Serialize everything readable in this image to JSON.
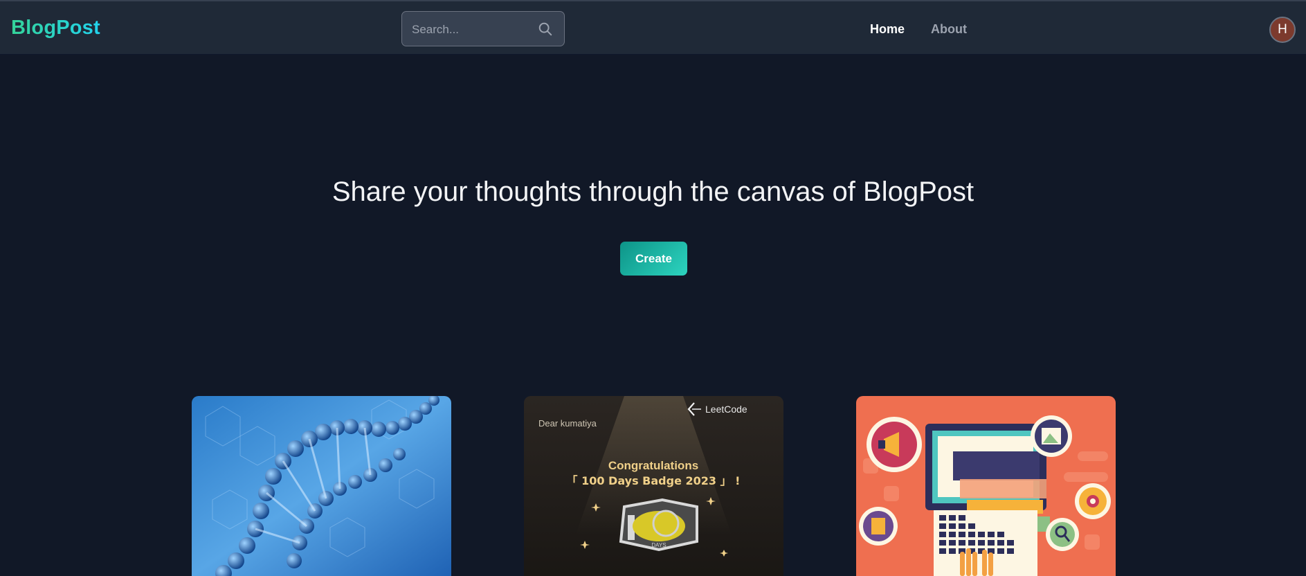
{
  "header": {
    "logo": "BlogPost",
    "search_placeholder": "Search...",
    "nav": {
      "home": "Home",
      "about": "About"
    },
    "avatar_initial": "H"
  },
  "hero": {
    "title": "Share your thoughts through the canvas of BlogPost",
    "create_label": "Create"
  },
  "cards": [
    {
      "image": "dna-helix-image"
    },
    {
      "image": "leetcode-badge-image",
      "image_text": {
        "brand": "LeetCode",
        "greeting": "Dear kumatiya",
        "headline": "Congratulations",
        "badge": "「 100 Days Badge 2023 」 !",
        "badge_caption": "DAYS"
      }
    },
    {
      "image": "digital-marketing-laptop-image"
    }
  ],
  "colors": {
    "background": "#111827",
    "header": "#1f2937",
    "accent": "#14b8a6"
  }
}
